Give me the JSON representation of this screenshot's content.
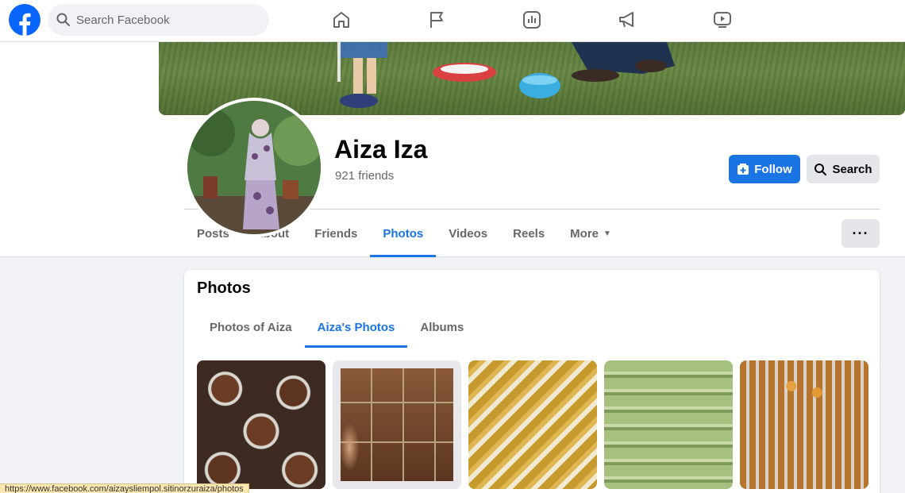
{
  "topnav": {
    "logo_icon": "facebook-logo-icon",
    "search_placeholder": "Search Facebook",
    "nav_icons": [
      "home-icon",
      "flag-icon",
      "chart-icon",
      "megaphone-icon",
      "video-icon"
    ]
  },
  "profile": {
    "name": "Aiza Iza",
    "friends": "921 friends",
    "follow_label": "Follow",
    "search_label": "Search"
  },
  "tabs": [
    {
      "label": "Posts",
      "active": false
    },
    {
      "label": "About",
      "active": false
    },
    {
      "label": "Friends",
      "active": false
    },
    {
      "label": "Photos",
      "active": true
    },
    {
      "label": "Videos",
      "active": false
    },
    {
      "label": "Reels",
      "active": false
    },
    {
      "label": "More",
      "active": false
    }
  ],
  "more_dots": "···",
  "photos": {
    "title": "Photos",
    "subtabs": [
      {
        "label": "Photos of Aiza",
        "active": false
      },
      {
        "label": "Aiza's Photos",
        "active": true
      },
      {
        "label": "Albums",
        "active": false
      }
    ]
  },
  "status_url": "https://www.facebook.com/aizaysliempol.sitinorzuraiza/photos",
  "colors": {
    "accent": "#1b74e4",
    "background": "#f0f2f5",
    "button_secondary": "#e4e6eb"
  }
}
